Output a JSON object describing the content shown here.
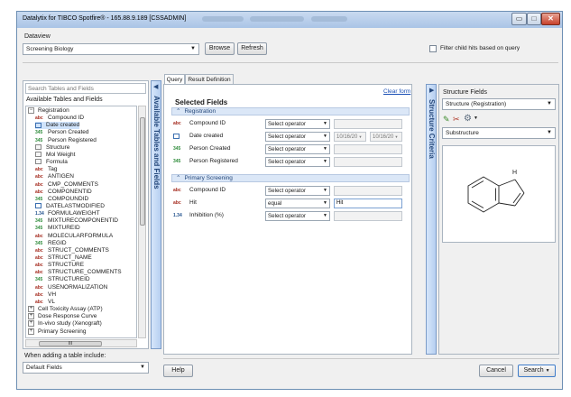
{
  "window": {
    "title": "Datalytix for TIBCO Spotfire® - 165.88.9.189 [CSSADMIN]",
    "min_glyph": "▭",
    "max_glyph": "□",
    "close_glyph": "✕"
  },
  "dataview": {
    "label": "Dataview",
    "selected": "Screening Biology",
    "browse_label": "Browse",
    "refresh_label": "Refresh",
    "filter_child_label": "Filter child hits based on query"
  },
  "left_panel": {
    "search_placeholder": "Search Tables and Fields",
    "tree_label": "Available Tables and Fields",
    "tab_label": "Available Tables and Fields",
    "tree": [
      {
        "kind": "root",
        "label": "Registration"
      },
      {
        "kind": "abc",
        "icon": "abc",
        "label": "Compound ID"
      },
      {
        "kind": "cal",
        "icon": "",
        "label": "Date created",
        "selected": true
      },
      {
        "kind": "n345",
        "icon": "345",
        "label": "Person Created"
      },
      {
        "kind": "n345",
        "icon": "345",
        "label": "Person Registered"
      },
      {
        "kind": "struct",
        "icon": "",
        "label": "Structure"
      },
      {
        "kind": "struct",
        "icon": "",
        "label": "Mol Weight"
      },
      {
        "kind": "struct",
        "icon": "",
        "label": "Formula"
      },
      {
        "kind": "abc",
        "icon": "abc",
        "label": "Tag"
      },
      {
        "kind": "abc",
        "icon": "abc",
        "label": "ANTIGEN"
      },
      {
        "kind": "abc",
        "icon": "abc",
        "label": "CMP_COMMENTS"
      },
      {
        "kind": "abc",
        "icon": "abc",
        "label": "COMPONENTID"
      },
      {
        "kind": "n345",
        "icon": "345",
        "label": "COMPOUNDID"
      },
      {
        "kind": "cal",
        "icon": "",
        "label": "DATELASTMODIFIED"
      },
      {
        "kind": "n134",
        "icon": "1.34",
        "label": "FORMULAWEIGHT"
      },
      {
        "kind": "n345",
        "icon": "345",
        "label": "MIXTURECOMPONENTID"
      },
      {
        "kind": "n345",
        "icon": "345",
        "label": "MIXTUREID"
      },
      {
        "kind": "abc",
        "icon": "abc",
        "label": "MOLECULARFORMULA"
      },
      {
        "kind": "n345",
        "icon": "345",
        "label": "REGID"
      },
      {
        "kind": "abc",
        "icon": "abc",
        "label": "STRUCT_COMMENTS"
      },
      {
        "kind": "abc",
        "icon": "abc",
        "label": "STRUCT_NAME"
      },
      {
        "kind": "abc",
        "icon": "abc",
        "label": "STRUCTURE"
      },
      {
        "kind": "abc",
        "icon": "abc",
        "label": "STRUCTURE_COMMENTS"
      },
      {
        "kind": "n345",
        "icon": "345",
        "label": "STRUCTUREID"
      },
      {
        "kind": "abc",
        "icon": "abc",
        "label": "USENORMALIZATION"
      },
      {
        "kind": "abc",
        "icon": "abc",
        "label": "VH"
      },
      {
        "kind": "abc",
        "icon": "abc",
        "label": "VL"
      },
      {
        "kind": "expand",
        "icon": "+",
        "label": "Cell Toxicity Assay (ATP)"
      },
      {
        "kind": "expand",
        "icon": "+",
        "label": "Dose Response Curve"
      },
      {
        "kind": "expand",
        "icon": "+",
        "label": "In-vivo study (Xenograft)"
      },
      {
        "kind": "expand",
        "icon": "+",
        "label": "Primary Screening"
      }
    ],
    "hscroll_label": "III",
    "when_adding_label": "When adding a table include:",
    "default_fields": "Default Fields"
  },
  "center": {
    "tabs": [
      {
        "label": "Query",
        "active": true
      },
      {
        "label": "Result Definition",
        "active": false
      }
    ],
    "clear_form": "Clear form",
    "selected_fields_label": "Selected Fields",
    "sections": [
      {
        "title": "Registration",
        "rows": [
          {
            "type": "abc",
            "label": "Compound ID",
            "operator": "Select operator",
            "value": "",
            "value2": "",
            "calendar": false
          },
          {
            "type": "cal",
            "label": "Date created",
            "operator": "Select operator",
            "value": "10/16/20",
            "value2": "10/16/20",
            "calendar": true
          },
          {
            "type": "345",
            "label": "Person Created",
            "operator": "Select operator",
            "value": "",
            "value2": "",
            "calendar": false
          },
          {
            "type": "345",
            "label": "Person Registered",
            "operator": "Select operator",
            "value": "",
            "value2": "",
            "calendar": false
          }
        ]
      },
      {
        "title": "Primary Screening",
        "rows": [
          {
            "type": "abc",
            "label": "Compound ID",
            "operator": "Select operator",
            "value": "",
            "value2": "",
            "calendar": false
          },
          {
            "type": "abc",
            "label": "Hit",
            "operator": "equal",
            "value": "Hit",
            "value2": "",
            "calendar": false,
            "active": true
          },
          {
            "type": "1.34",
            "label": "Inhibition (%)",
            "operator": "Select operator",
            "value": "",
            "value2": "",
            "calendar": false
          }
        ]
      }
    ],
    "collapse_glyph": "⌃",
    "help_label": "Help"
  },
  "right": {
    "tab_label": "Structure Criteria",
    "structure_fields_label": "Structure Fields",
    "structure_field": "Structure (Registration)",
    "search_type": "Substructure",
    "atom_label": "H"
  },
  "bottom": {
    "cancel_label": "Cancel",
    "search_label": "Search"
  }
}
